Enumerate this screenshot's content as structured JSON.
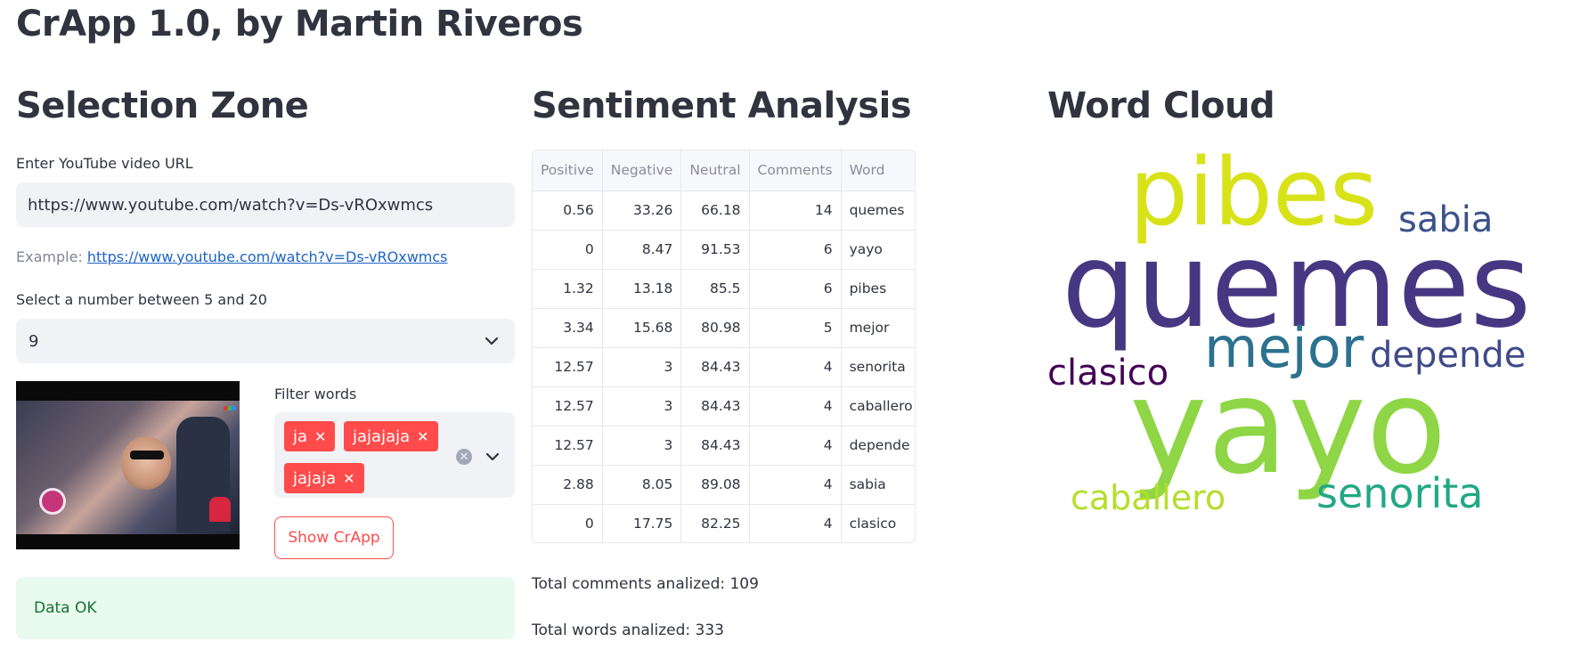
{
  "app": {
    "title": "CrApp 1.0, by Martin Riveros"
  },
  "selection": {
    "heading": "Selection Zone",
    "url_label": "Enter YouTube video URL",
    "url_value": "https://www.youtube.com/watch?v=Ds-vROxwmcs",
    "example_prefix": "Example: ",
    "example_link": "https://www.youtube.com/watch?v=Ds-vROxwmcs",
    "number_label": "Select a number between 5 and 20",
    "number_value": "9",
    "filter_label": "Filter words",
    "filter_chips": [
      "ja",
      "jajajaja",
      "jajaja"
    ],
    "show_button": "Show CrApp",
    "status": "Data OK",
    "chip_color": "#ff4b4b"
  },
  "sentiment": {
    "heading": "Sentiment Analysis",
    "columns": [
      "Positive",
      "Negative",
      "Neutral",
      "Comments",
      "Word"
    ],
    "rows": [
      [
        "0.56",
        "33.26",
        "66.18",
        "14",
        "quemes"
      ],
      [
        "0",
        "8.47",
        "91.53",
        "6",
        "yayo"
      ],
      [
        "1.32",
        "13.18",
        "85.5",
        "6",
        "pibes"
      ],
      [
        "3.34",
        "15.68",
        "80.98",
        "5",
        "mejor"
      ],
      [
        "12.57",
        "3",
        "84.43",
        "4",
        "senorita"
      ],
      [
        "12.57",
        "3",
        "84.43",
        "4",
        "caballero"
      ],
      [
        "12.57",
        "3",
        "84.43",
        "4",
        "depende"
      ],
      [
        "2.88",
        "8.05",
        "89.08",
        "4",
        "sabia"
      ],
      [
        "0",
        "17.75",
        "82.25",
        "4",
        "clasico"
      ]
    ],
    "total_comments": "Total comments analized: 109",
    "total_words": "Total words analized: 333"
  },
  "wordcloud": {
    "heading": "Word Cloud",
    "words": [
      {
        "text": "quemes",
        "color": "#453781"
      },
      {
        "text": "yayo",
        "color": "#8ed645"
      },
      {
        "text": "pibes",
        "color": "#d8e219"
      },
      {
        "text": "sabia",
        "color": "#3b528b"
      },
      {
        "text": "mejor",
        "color": "#2c728e"
      },
      {
        "text": "depende",
        "color": "#3e4a89"
      },
      {
        "text": "clasico",
        "color": "#440154"
      },
      {
        "text": "caballero",
        "color": "#b5de2b"
      },
      {
        "text": "senorita",
        "color": "#22a884"
      }
    ]
  }
}
